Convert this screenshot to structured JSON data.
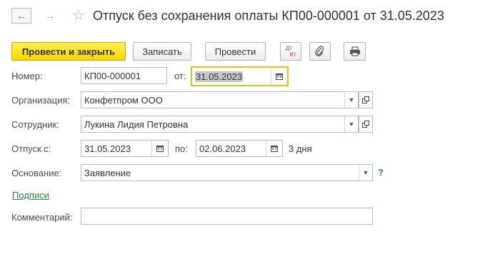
{
  "header": {
    "title": "Отпуск без сохранения оплаты КП00-000001 от 31.05.2023"
  },
  "toolbar": {
    "post_close_label": "Провести и закрыть",
    "save_label": "Записать",
    "post_label": "Провести",
    "dtkt_top": "Дт",
    "dtkt_bottom": "Кт"
  },
  "form": {
    "number_label": "Номер:",
    "number_value": "КП00-000001",
    "date_from_label": "от:",
    "date_value": "31.05.2023",
    "org_label": "Организация:",
    "org_value": "Конфетпром ООО",
    "employee_label": "Сотрудник:",
    "employee_value": "Лукина Лидия Петровна",
    "leave_from_label": "Отпуск с:",
    "leave_from_value": "31.05.2023",
    "leave_to_label": "по:",
    "leave_to_value": "02.06.2023",
    "duration_text": "3 дня",
    "basis_label": "Основание:",
    "basis_value": "Заявление",
    "help_mark": "?",
    "signatures_link": "Подписи",
    "comment_label": "Комментарий:",
    "comment_value": ""
  },
  "colors": {
    "primary_button": "#f5d600",
    "active_border": "#e8c100",
    "link": "#2a8a3f",
    "help": "#2f6fb5"
  },
  "icons": [
    "arrow-left-icon",
    "arrow-right-icon",
    "star-icon",
    "dtkt-icon",
    "paperclip-icon",
    "printer-icon",
    "calendar-icon",
    "chevron-down-icon",
    "open-form-icon"
  ]
}
